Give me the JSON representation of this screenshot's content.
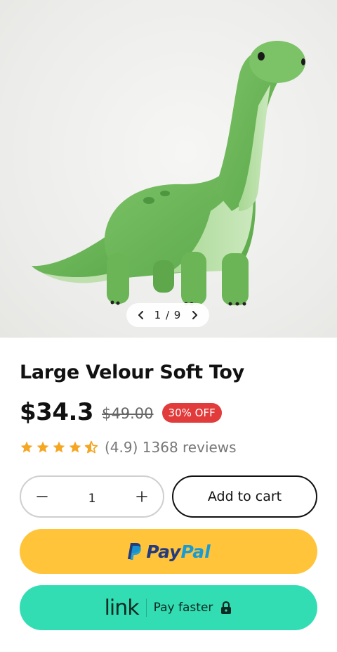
{
  "product": {
    "image_alt": "green plush brachiosaurus toy",
    "pager": {
      "current": "1",
      "total": "9",
      "text": "1 / 9"
    },
    "title": "Large Velour Soft Toy",
    "price": "$34.3",
    "old_price": "$49.00",
    "discount_badge": "30% OFF",
    "rating": {
      "stars": 4.5,
      "text": "(4.9) 1368 reviews"
    }
  },
  "quantity": {
    "value": "1",
    "decrement_icon": "minus-icon",
    "increment_icon": "plus-icon"
  },
  "actions": {
    "add_to_cart": "Add to cart",
    "paypal": {
      "pay": "Pay",
      "pal": "Pal"
    },
    "link": {
      "brand": "link",
      "label": "Pay faster",
      "icon": "lock-icon"
    }
  },
  "colors": {
    "badge": "#e23b3b",
    "paypal_bg": "#ffc439",
    "paypal_dark": "#253b80",
    "paypal_light": "#179bd7",
    "link_bg": "#33ddb3",
    "star": "#f5a623"
  }
}
